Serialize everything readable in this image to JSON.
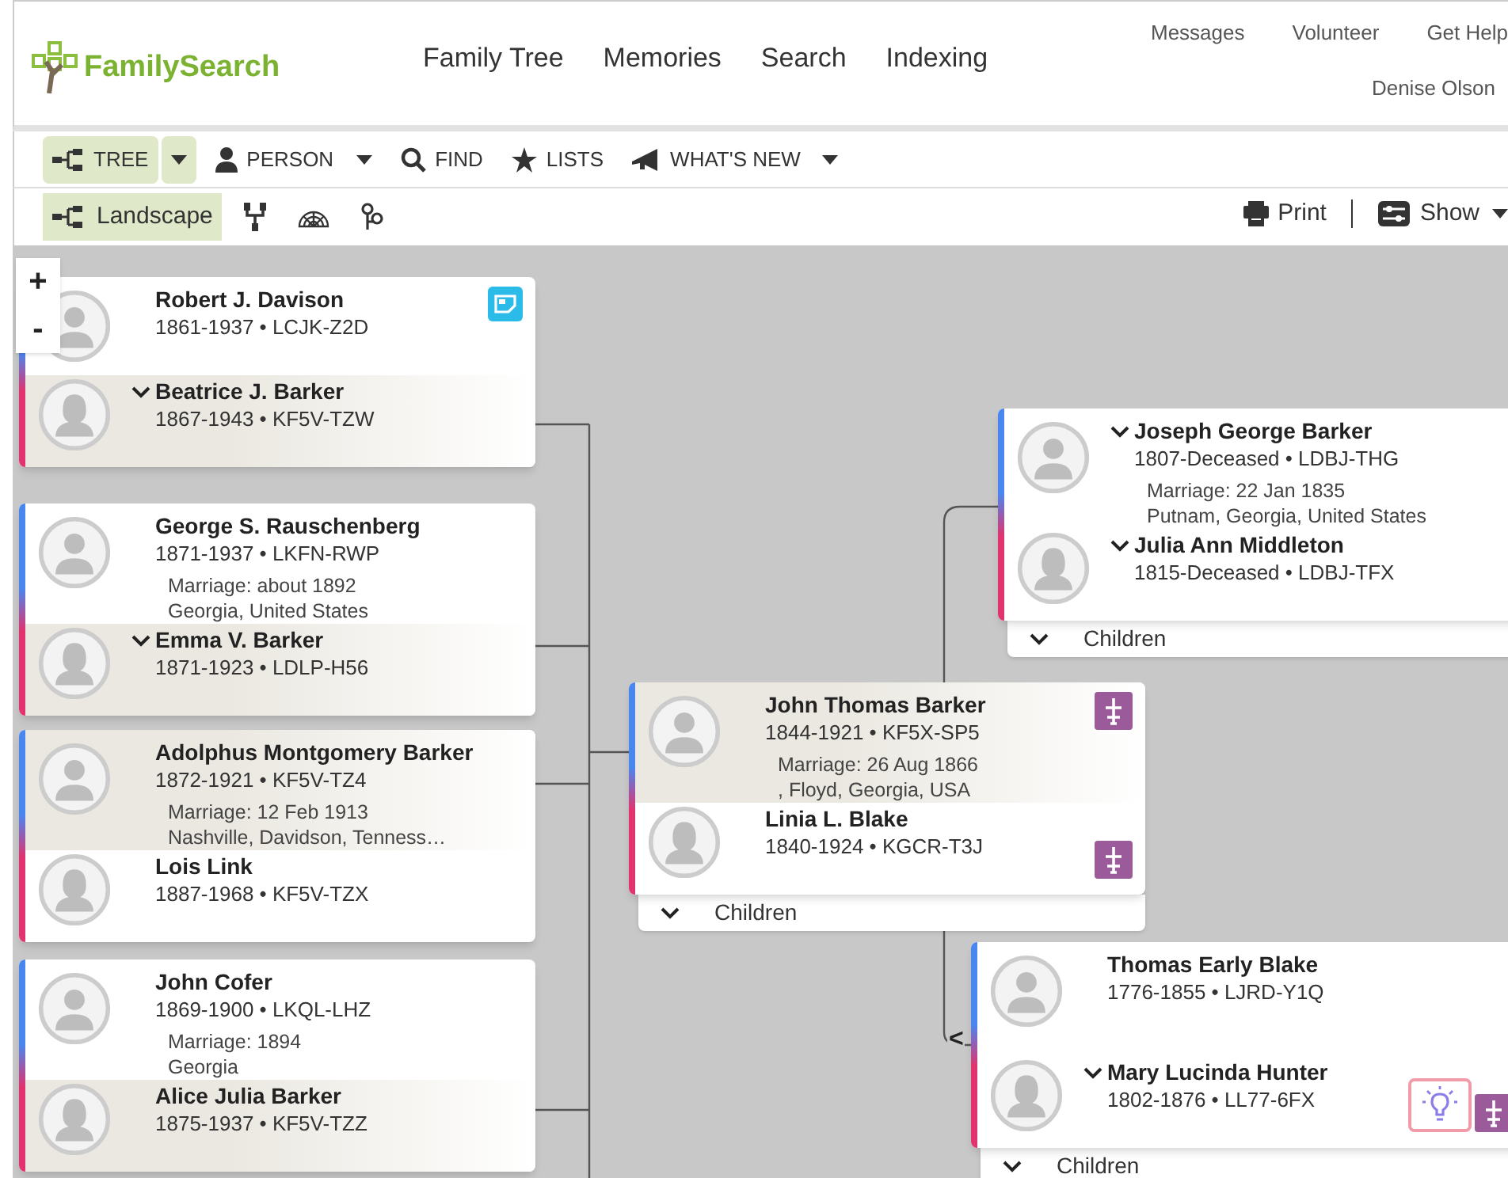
{
  "header": {
    "logo": "FamilySearch",
    "nav": [
      "Family Tree",
      "Memories",
      "Search",
      "Indexing"
    ],
    "top_links": [
      "Messages",
      "Volunteer",
      "Get Help"
    ],
    "user": "Denise Olson"
  },
  "toolbar": [
    {
      "label": "TREE",
      "selected": true,
      "split": true,
      "caret": true
    },
    {
      "label": "PERSON",
      "selected": false,
      "split": false,
      "caret": true
    },
    {
      "label": "FIND",
      "selected": false,
      "split": false,
      "caret": false
    },
    {
      "label": "LISTS",
      "selected": false,
      "split": false,
      "caret": false
    },
    {
      "label": "WHAT'S NEW",
      "selected": false,
      "split": false,
      "caret": true
    }
  ],
  "views": [
    {
      "label": "Landscape",
      "selected": true
    },
    {
      "selected": false
    },
    {
      "selected": false
    },
    {
      "selected": false
    }
  ],
  "actions": [
    "Print",
    "Show"
  ],
  "zoom": [
    "+",
    "-"
  ],
  "couples": [
    {
      "husband": {
        "name": "Robert J. Davison",
        "dates": "1861-1937 • LCJK-Z2D",
        "menu": false,
        "direct_line": false,
        "note": true
      },
      "wife": {
        "name": "Beatrice J. Barker",
        "dates": "1867-1943 • KF5V-TZW",
        "menu": true,
        "direct_line": true
      }
    },
    {
      "husband": {
        "name": "George S. Rauschenberg",
        "dates": "1871-1937 • LKFN-RWP",
        "menu": false,
        "direct_line": false
      },
      "marriage": [
        "Marriage: about 1892",
        "Georgia, United States"
      ],
      "wife": {
        "name": "Emma V. Barker",
        "dates": "1871-1923 • LDLP-H56",
        "menu": true,
        "direct_line": true
      }
    },
    {
      "husband": {
        "name": "Adolphus Montgomery Barker",
        "dates": "1872-1921 • KF5V-TZ4",
        "menu": false,
        "direct_line": true
      },
      "marriage": [
        "Marriage: 12 Feb 1913",
        "Nashville, Davidson, Tenness…"
      ],
      "wife": {
        "name": "Lois Link",
        "dates": "1887-1968 • KF5V-TZX",
        "menu": false,
        "direct_line": false
      }
    },
    {
      "husband": {
        "name": "John Cofer",
        "dates": "1869-1900 • LKQL-LHZ",
        "menu": false,
        "direct_line": false
      },
      "marriage": [
        "Marriage: 1894",
        "Georgia"
      ],
      "wife": {
        "name": "Alice Julia Barker",
        "dates": "1875-1937 • KF5V-TZZ",
        "menu": false,
        "direct_line": true
      }
    },
    {
      "husband": {
        "name": "John Thomas Barker",
        "dates": "1844-1921 • KF5X-SP5",
        "menu": false,
        "direct_line": true,
        "temple": true
      },
      "marriage": [
        "Marriage: 26 Aug 1866",
        ", Floyd, Georgia, USA"
      ],
      "wife": {
        "name": "Linia L. Blake",
        "dates": "1840-1924 • KGCR-T3J",
        "menu": false,
        "direct_line": false,
        "temple": true
      },
      "children": "Children"
    },
    {
      "husband": {
        "name": "Joseph George Barker",
        "dates": "1807-Deceased • LDBJ-THG",
        "menu": true,
        "direct_line": false
      },
      "marriage": [
        "Marriage: 22 Jan 1835",
        "Putnam, Georgia, United States"
      ],
      "wife": {
        "name": "Julia Ann Middleton",
        "dates": "1815-Deceased • LDBJ-TFX",
        "menu": true,
        "direct_line": false
      },
      "children": "Children"
    },
    {
      "husband": {
        "name": "Thomas Early Blake",
        "dates": "1776-1855 • LJRD-Y1Q",
        "menu": false,
        "direct_line": false
      },
      "wife": {
        "name": "Mary Lucinda Hunter",
        "dates": "1802-1876 • LL77-6FX",
        "menu": true,
        "direct_line": false,
        "hint": true,
        "temple": true
      },
      "children": "Children",
      "back": "<"
    }
  ]
}
